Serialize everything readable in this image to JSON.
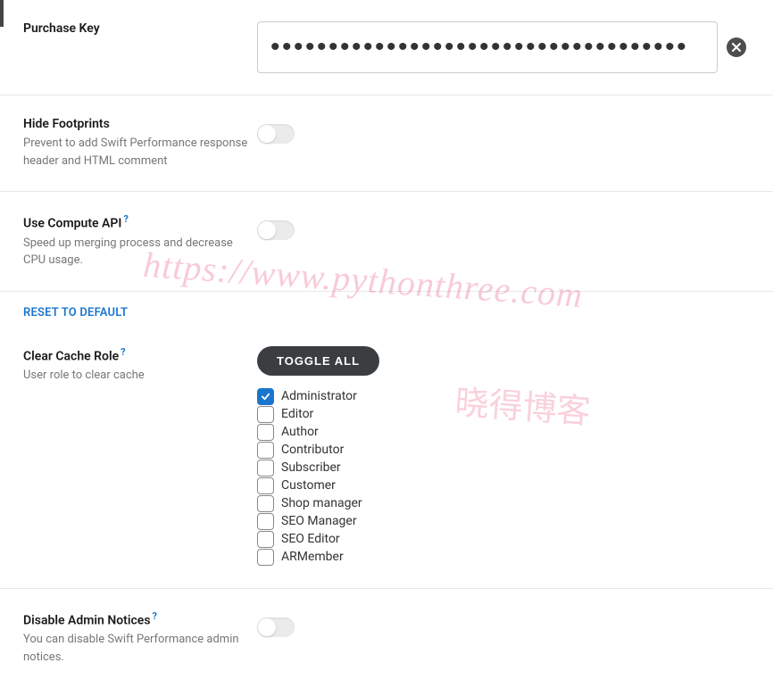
{
  "purchase_key": {
    "label": "Purchase Key",
    "value": "••••••••••••••••••••••••••••••••••••"
  },
  "hide_footprints": {
    "label": "Hide Footprints",
    "desc": "Prevent to add Swift Performance response header and HTML comment"
  },
  "use_compute_api": {
    "label": "Use Compute API",
    "desc": "Speed up merging process and decrease CPU usage."
  },
  "reset_link": "RESET TO DEFAULT",
  "clear_cache_role": {
    "label": "Clear Cache Role",
    "desc": "User role to clear cache",
    "toggle_all": "TOGGLE ALL",
    "roles": [
      {
        "label": "Administrator",
        "checked": true
      },
      {
        "label": "Editor",
        "checked": false
      },
      {
        "label": "Author",
        "checked": false
      },
      {
        "label": "Contributor",
        "checked": false
      },
      {
        "label": "Subscriber",
        "checked": false
      },
      {
        "label": "Customer",
        "checked": false
      },
      {
        "label": "Shop manager",
        "checked": false
      },
      {
        "label": "SEO Manager",
        "checked": false
      },
      {
        "label": "SEO Editor",
        "checked": false
      },
      {
        "label": "ARMember",
        "checked": false
      }
    ]
  },
  "disable_admin_notices": {
    "label": "Disable Admin Notices",
    "desc": "You can disable Swift Performance admin notices."
  },
  "help_symbol": "?",
  "watermark1": "https://www.pythonthree.com",
  "watermark2": "晓得博客"
}
